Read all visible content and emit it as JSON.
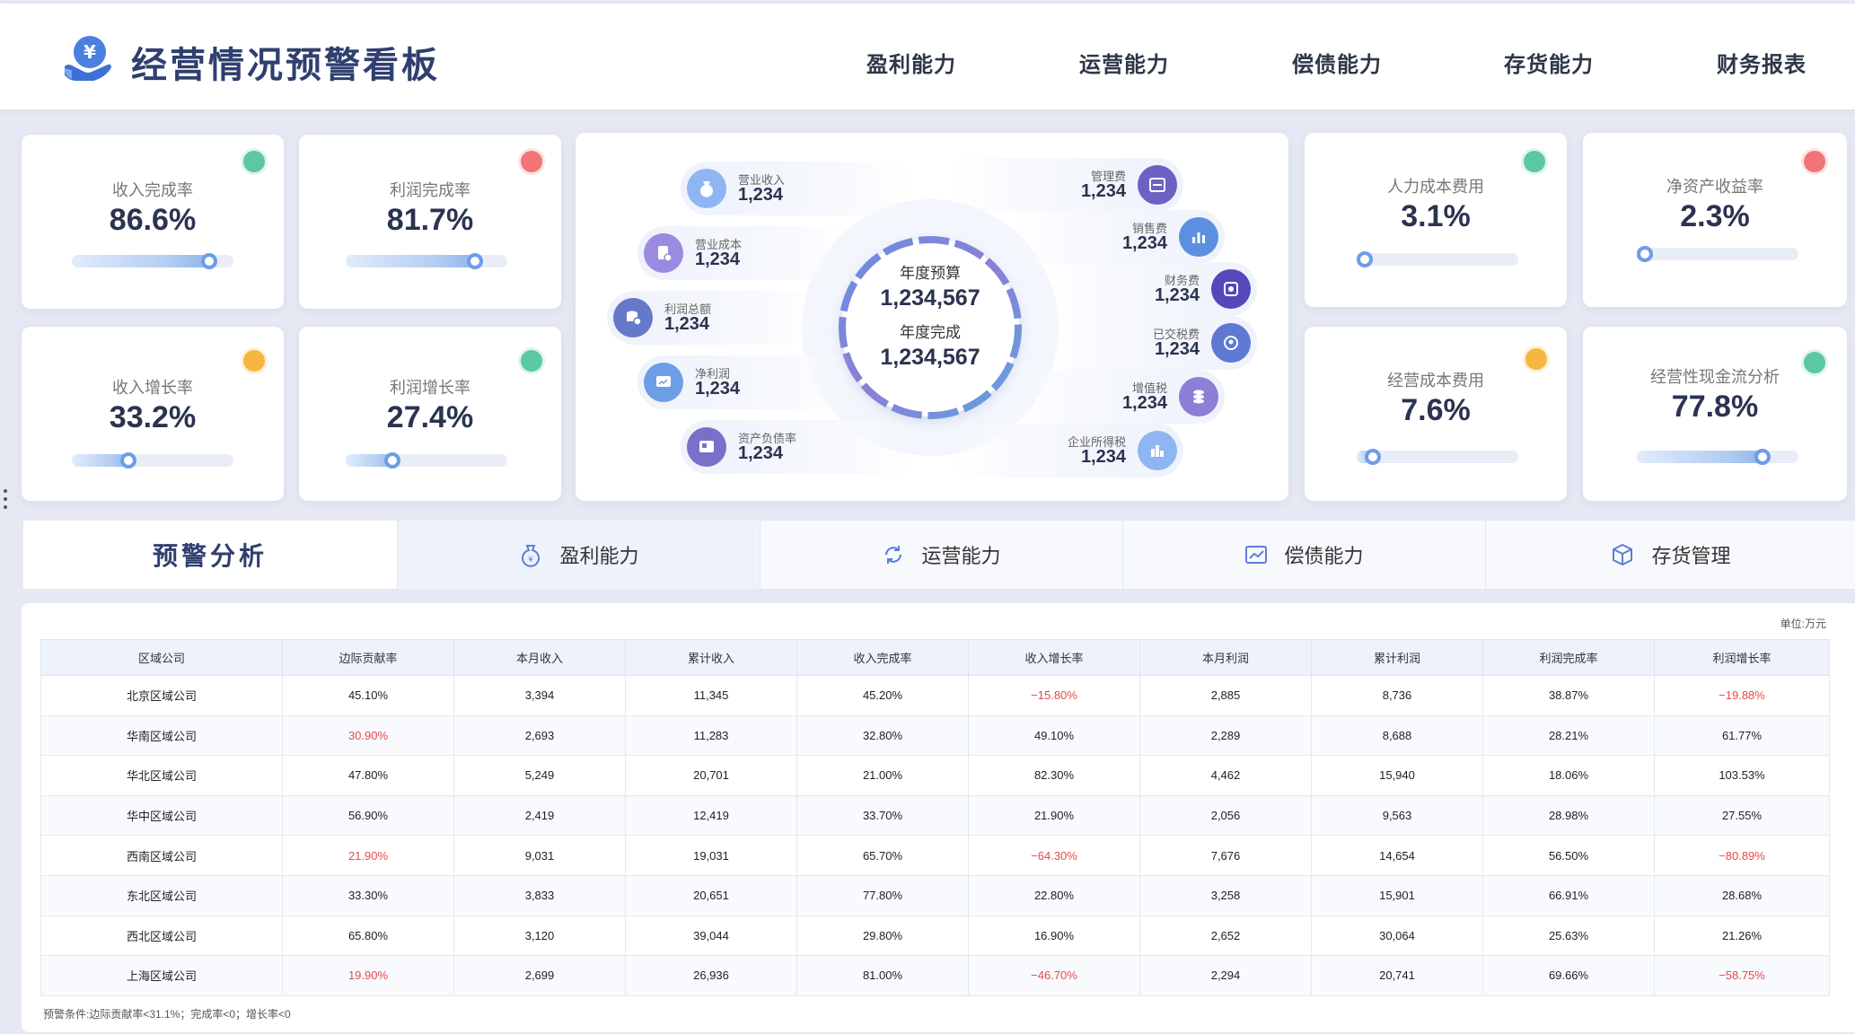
{
  "header": {
    "title": "经营情况预警看板",
    "nav": [
      "盈利能力",
      "运营能力",
      "偿债能力",
      "存货能力",
      "财务报表"
    ]
  },
  "kpis": [
    {
      "label": "收入完成率",
      "value": "86.6%",
      "status": "#5cc7a3",
      "level": 0.85
    },
    {
      "label": "利润完成率",
      "value": "81.7%",
      "status": "#f17575",
      "level": 0.8
    },
    {
      "label": "收入增长率",
      "value": "33.2%",
      "status": "#f5b73f",
      "level": 0.35
    },
    {
      "label": "利润增长率",
      "value": "27.4%",
      "status": "#5cc7a3",
      "level": 0.29
    },
    {
      "label": "人力成本费用",
      "value": "3.1%",
      "status": "#5cc7a3",
      "level": 0.05
    },
    {
      "label": "净资产收益率",
      "value": "2.3%",
      "status": "#f17575",
      "level": 0.04
    },
    {
      "label": "经营成本费用",
      "value": "7.6%",
      "status": "#f5b73f",
      "level": 0.1
    },
    {
      "label": "经营性现金流分析",
      "value": "77.8%",
      "status": "#5cc7a3",
      "level": 0.78
    }
  ],
  "center": {
    "budget_label": "年度预算",
    "budget_value": "1,234,567",
    "done_label": "年度完成",
    "done_value": "1,234,567",
    "left_items": [
      {
        "label": "营业收入",
        "value": "1,234",
        "icon": "revenue-icon"
      },
      {
        "label": "营业成本",
        "value": "1,234",
        "icon": "cost-icon"
      },
      {
        "label": "利润总额",
        "value": "1,234",
        "icon": "profit-total-icon"
      },
      {
        "label": "净利润",
        "value": "1,234",
        "icon": "net-profit-icon"
      },
      {
        "label": "资产负债率",
        "value": "1,234",
        "icon": "debt-ratio-icon"
      }
    ],
    "right_items": [
      {
        "label": "管理费",
        "value": "1,234",
        "icon": "management-fee-icon"
      },
      {
        "label": "销售费",
        "value": "1,234",
        "icon": "sales-fee-icon"
      },
      {
        "label": "财务费",
        "value": "1,234",
        "icon": "finance-fee-icon"
      },
      {
        "label": "已交税费",
        "value": "1,234",
        "icon": "tax-paid-icon"
      },
      {
        "label": "增值税",
        "value": "1,234",
        "icon": "vat-icon"
      },
      {
        "label": "企业所得税",
        "value": "1,234",
        "icon": "income-tax-icon"
      }
    ]
  },
  "tabs": {
    "heading": "预警分析",
    "items": [
      "盈利能力",
      "运营能力",
      "偿债能力",
      "存货管理"
    ]
  },
  "table": {
    "unit": "单位:万元",
    "columns": [
      "区域公司",
      "边际贡献率",
      "本月收入",
      "累计收入",
      "收入完成率",
      "收入增长率",
      "本月利润",
      "累计利润",
      "利润完成率",
      "利润增长率"
    ],
    "rows": [
      [
        "北京区域公司",
        "45.10%",
        "3,394",
        "11,345",
        "45.20%",
        "−15.80%",
        "2,885",
        "8,736",
        "38.87%",
        "−19.88%"
      ],
      [
        "华南区域公司",
        "30.90%",
        "2,693",
        "11,283",
        "32.80%",
        "49.10%",
        "2,289",
        "8,688",
        "28.21%",
        "61.77%"
      ],
      [
        "华北区域公司",
        "47.80%",
        "5,249",
        "20,701",
        "21.00%",
        "82.30%",
        "4,462",
        "15,940",
        "18.06%",
        "103.53%"
      ],
      [
        "华中区域公司",
        "56.90%",
        "2,419",
        "12,419",
        "33.70%",
        "21.90%",
        "2,056",
        "9,563",
        "28.98%",
        "27.55%"
      ],
      [
        "西南区域公司",
        "21.90%",
        "9,031",
        "19,031",
        "65.70%",
        "−64.30%",
        "7,676",
        "14,654",
        "56.50%",
        "−80.89%"
      ],
      [
        "东北区域公司",
        "33.30%",
        "3,833",
        "20,651",
        "77.80%",
        "22.80%",
        "3,258",
        "15,901",
        "66.91%",
        "28.68%"
      ],
      [
        "西北区域公司",
        "65.80%",
        "3,120",
        "39,044",
        "29.80%",
        "16.90%",
        "2,652",
        "30,064",
        "25.63%",
        "21.26%"
      ],
      [
        "上海区域公司",
        "19.90%",
        "2,699",
        "26,936",
        "81.00%",
        "−46.70%",
        "2,294",
        "20,741",
        "69.66%",
        "−58.75%"
      ]
    ],
    "alert_color": "#e64a4a",
    "condition": "预警条件:边际贡献率<31.1%；完成率<0；增长率<0"
  }
}
